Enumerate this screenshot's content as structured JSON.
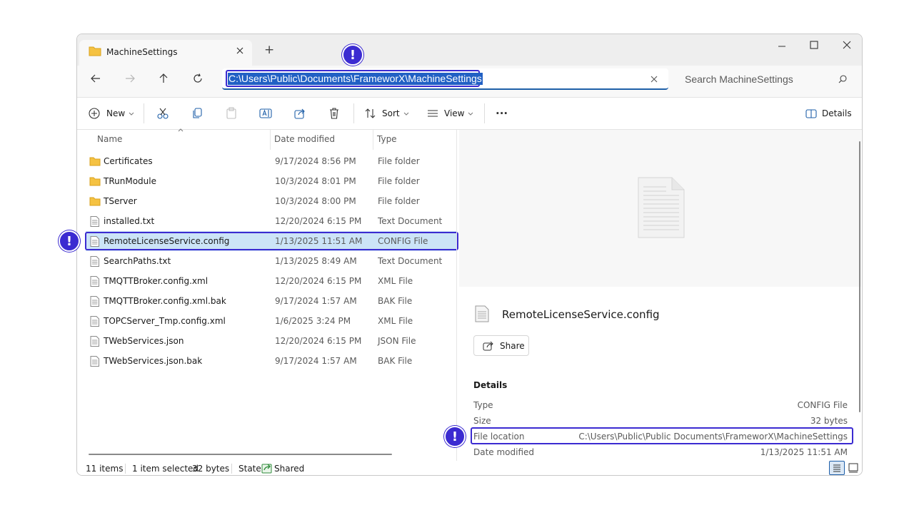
{
  "window": {
    "tab_title": "MachineSettings",
    "new_tab_glyph": "+",
    "controls": [
      "minimize-icon",
      "maximize-icon",
      "close-icon"
    ]
  },
  "address": {
    "path": "C:\\Users\\Public\\Documents\\FrameworX\\MachineSettings",
    "search_placeholder": "Search MachineSettings"
  },
  "toolbar": {
    "new_label": "New",
    "sort_label": "Sort",
    "view_label": "View",
    "more_label": "···",
    "details_label": "Details"
  },
  "columns": {
    "name": "Name",
    "date": "Date modified",
    "type": "Type"
  },
  "files": [
    {
      "name": "Certificates",
      "date": "9/17/2024 8:56 PM",
      "type": "File folder",
      "kind": "folder"
    },
    {
      "name": "TRunModule",
      "date": "10/3/2024 8:01 PM",
      "type": "File folder",
      "kind": "folder"
    },
    {
      "name": "TServer",
      "date": "10/3/2024 8:00 PM",
      "type": "File folder",
      "kind": "folder"
    },
    {
      "name": "installed.txt",
      "date": "12/20/2024 6:15 PM",
      "type": "Text Document",
      "kind": "file"
    },
    {
      "name": "RemoteLicenseService.config",
      "date": "1/13/2025 11:51 AM",
      "type": "CONFIG File",
      "kind": "file",
      "selected": true
    },
    {
      "name": "SearchPaths.txt",
      "date": "1/13/2025 8:49 AM",
      "type": "Text Document",
      "kind": "file"
    },
    {
      "name": "TMQTTBroker.config.xml",
      "date": "12/20/2024 6:15 PM",
      "type": "XML File",
      "kind": "file"
    },
    {
      "name": "TMQTTBroker.config.xml.bak",
      "date": "9/17/2024 1:57 AM",
      "type": "BAK File",
      "kind": "file"
    },
    {
      "name": "TOPCServer_Tmp.config.xml",
      "date": "1/6/2025 3:24 PM",
      "type": "XML File",
      "kind": "file"
    },
    {
      "name": "TWebServices.json",
      "date": "12/20/2024 6:15 PM",
      "type": "JSON File",
      "kind": "file"
    },
    {
      "name": "TWebServices.json.bak",
      "date": "9/17/2024 1:57 AM",
      "type": "BAK File",
      "kind": "file"
    }
  ],
  "details": {
    "file_name": "RemoteLicenseService.config",
    "share_label": "Share",
    "section_title": "Details",
    "type_label": "Type",
    "type_value": "CONFIG File",
    "size_label": "Size",
    "size_value": "32 bytes",
    "location_label": "File location",
    "location_value": "C:\\Users\\Public\\Public Documents\\FrameworX\\MachineSettings",
    "modified_label": "Date modified",
    "modified_value": "1/13/2025 11:51 AM"
  },
  "status": {
    "items": "11 items",
    "selected": "1 item selected",
    "size": "32 bytes",
    "state_label": "State:",
    "state_value": "Shared"
  },
  "markers": {
    "glyph": "!"
  },
  "colors": {
    "accent": "#3b2bd1",
    "selection": "#cce4f7",
    "folder": "#f5c242",
    "address_highlight": "#2160c4"
  }
}
